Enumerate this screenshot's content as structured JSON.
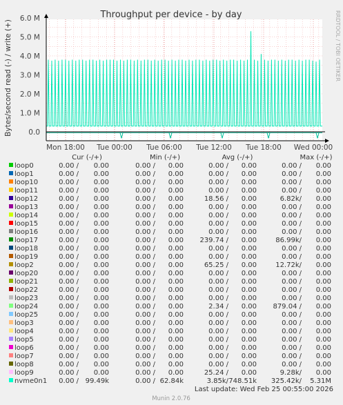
{
  "chart_data": {
    "type": "line",
    "title": "Throughput per device - by day",
    "ylabel": "Bytes/second read (-) / write (+)",
    "ylim": [
      -0.3,
      6.0
    ],
    "y_unit": "M",
    "y_ticks": [
      "0.0",
      "1.0 M",
      "2.0 M",
      "3.0 M",
      "4.0 M",
      "5.0 M",
      "6.0 M"
    ],
    "x_ticks": [
      "Mon 18:00",
      "Tue 00:00",
      "Tue 06:00",
      "Tue 12:00",
      "Tue 18:00",
      "Wed 00:00"
    ],
    "x_range": [
      "Mon 14:00",
      "Wed 02:40"
    ],
    "grid": true,
    "series": [
      {
        "name": "nvme0n1",
        "color": "#00E6B4",
        "approx_write_peaks_M": [
          3.8,
          3.75,
          3.8,
          3.75,
          3.8,
          3.8,
          3.75,
          3.8,
          3.75,
          3.8,
          3.8,
          3.75,
          3.8,
          3.8,
          3.75,
          3.8,
          3.75,
          3.8,
          3.8,
          3.8,
          3.75,
          3.8,
          3.75,
          3.8,
          3.8,
          3.75,
          3.8,
          3.75,
          3.8,
          3.8,
          3.75,
          3.8,
          3.75,
          3.8,
          3.8,
          3.75,
          3.8,
          3.75,
          3.8,
          3.8,
          3.75,
          3.8,
          3.75,
          3.8,
          3.8,
          3.75,
          3.8,
          3.75,
          3.8,
          3.8,
          3.75,
          3.8,
          3.75,
          3.8,
          3.8,
          3.75,
          3.8,
          3.75,
          3.8,
          5.3,
          3.8,
          3.75,
          4.1,
          3.8,
          3.75,
          3.8,
          3.8,
          3.75,
          3.8,
          3.75,
          3.8,
          3.8,
          3.75,
          3.8,
          3.75,
          3.8,
          3.8,
          3.75,
          3.7,
          3.8
        ],
        "write_baseline_M": 0.3,
        "read_baseline_M": -0.05
      }
    ]
  },
  "legend": {
    "headers": [
      "Cur (-/+)",
      "Min (-/+)",
      "Avg (-/+)",
      "Max (-/+)"
    ],
    "rows": [
      {
        "name": "loop0",
        "color": "#00CC00",
        "cur": "0.00 /",
        "cur2": "0.00",
        "min": "0.00 /",
        "min2": "0.00",
        "avg": "0.00 /",
        "avg2": "0.00",
        "max": "0.00 /",
        "max2": "0.00"
      },
      {
        "name": "loop1",
        "color": "#0066B3",
        "cur": "0.00 /",
        "cur2": "0.00",
        "min": "0.00 /",
        "min2": "0.00",
        "avg": "0.00 /",
        "avg2": "0.00",
        "max": "0.00 /",
        "max2": "0.00"
      },
      {
        "name": "loop10",
        "color": "#FF8000",
        "cur": "0.00 /",
        "cur2": "0.00",
        "min": "0.00 /",
        "min2": "0.00",
        "avg": "0.00 /",
        "avg2": "0.00",
        "max": "0.00 /",
        "max2": "0.00"
      },
      {
        "name": "loop11",
        "color": "#FFCC00",
        "cur": "0.00 /",
        "cur2": "0.00",
        "min": "0.00 /",
        "min2": "0.00",
        "avg": "0.00 /",
        "avg2": "0.00",
        "max": "0.00 /",
        "max2": "0.00"
      },
      {
        "name": "loop12",
        "color": "#330099",
        "cur": "0.00 /",
        "cur2": "0.00",
        "min": "0.00 /",
        "min2": "0.00",
        "avg": "18.56 /",
        "avg2": "0.00",
        "max": "6.82k/",
        "max2": "0.00"
      },
      {
        "name": "loop13",
        "color": "#990099",
        "cur": "0.00 /",
        "cur2": "0.00",
        "min": "0.00 /",
        "min2": "0.00",
        "avg": "0.00 /",
        "avg2": "0.00",
        "max": "0.00 /",
        "max2": "0.00"
      },
      {
        "name": "loop14",
        "color": "#CCFF00",
        "cur": "0.00 /",
        "cur2": "0.00",
        "min": "0.00 /",
        "min2": "0.00",
        "avg": "0.00 /",
        "avg2": "0.00",
        "max": "0.00 /",
        "max2": "0.00"
      },
      {
        "name": "loop15",
        "color": "#FF0000",
        "cur": "0.00 /",
        "cur2": "0.00",
        "min": "0.00 /",
        "min2": "0.00",
        "avg": "0.00 /",
        "avg2": "0.00",
        "max": "0.00 /",
        "max2": "0.00"
      },
      {
        "name": "loop16",
        "color": "#808080",
        "cur": "0.00 /",
        "cur2": "0.00",
        "min": "0.00 /",
        "min2": "0.00",
        "avg": "0.00 /",
        "avg2": "0.00",
        "max": "0.00 /",
        "max2": "0.00"
      },
      {
        "name": "loop17",
        "color": "#008F00",
        "cur": "0.00 /",
        "cur2": "0.00",
        "min": "0.00 /",
        "min2": "0.00",
        "avg": "239.74 /",
        "avg2": "0.00",
        "max": "86.99k/",
        "max2": "0.00"
      },
      {
        "name": "loop18",
        "color": "#00487D",
        "cur": "0.00 /",
        "cur2": "0.00",
        "min": "0.00 /",
        "min2": "0.00",
        "avg": "0.00 /",
        "avg2": "0.00",
        "max": "0.00 /",
        "max2": "0.00"
      },
      {
        "name": "loop19",
        "color": "#B35A00",
        "cur": "0.00 /",
        "cur2": "0.00",
        "min": "0.00 /",
        "min2": "0.00",
        "avg": "0.00 /",
        "avg2": "0.00",
        "max": "0.00 /",
        "max2": "0.00"
      },
      {
        "name": "loop2",
        "color": "#B38F00",
        "cur": "0.00 /",
        "cur2": "0.00",
        "min": "0.00 /",
        "min2": "0.00",
        "avg": "65.25 /",
        "avg2": "0.00",
        "max": "12.72k/",
        "max2": "0.00"
      },
      {
        "name": "loop20",
        "color": "#6B006B",
        "cur": "0.00 /",
        "cur2": "0.00",
        "min": "0.00 /",
        "min2": "0.00",
        "avg": "0.00 /",
        "avg2": "0.00",
        "max": "0.00 /",
        "max2": "0.00"
      },
      {
        "name": "loop21",
        "color": "#8FB300",
        "cur": "0.00 /",
        "cur2": "0.00",
        "min": "0.00 /",
        "min2": "0.00",
        "avg": "0.00 /",
        "avg2": "0.00",
        "max": "0.00 /",
        "max2": "0.00"
      },
      {
        "name": "loop22",
        "color": "#B30000",
        "cur": "0.00 /",
        "cur2": "0.00",
        "min": "0.00 /",
        "min2": "0.00",
        "avg": "0.00 /",
        "avg2": "0.00",
        "max": "0.00 /",
        "max2": "0.00"
      },
      {
        "name": "loop23",
        "color": "#BEBEBE",
        "cur": "0.00 /",
        "cur2": "0.00",
        "min": "0.00 /",
        "min2": "0.00",
        "avg": "0.00 /",
        "avg2": "0.00",
        "max": "0.00 /",
        "max2": "0.00"
      },
      {
        "name": "loop24",
        "color": "#80FF80",
        "cur": "0.00 /",
        "cur2": "0.00",
        "min": "0.00 /",
        "min2": "0.00",
        "avg": "2.34 /",
        "avg2": "0.00",
        "max": "879.04 /",
        "max2": "0.00"
      },
      {
        "name": "loop25",
        "color": "#80C9FF",
        "cur": "0.00 /",
        "cur2": "0.00",
        "min": "0.00 /",
        "min2": "0.00",
        "avg": "0.00 /",
        "avg2": "0.00",
        "max": "0.00 /",
        "max2": "0.00"
      },
      {
        "name": "loop3",
        "color": "#FFC080",
        "cur": "0.00 /",
        "cur2": "0.00",
        "min": "0.00 /",
        "min2": "0.00",
        "avg": "0.00 /",
        "avg2": "0.00",
        "max": "0.00 /",
        "max2": "0.00"
      },
      {
        "name": "loop4",
        "color": "#FFE680",
        "cur": "0.00 /",
        "cur2": "0.00",
        "min": "0.00 /",
        "min2": "0.00",
        "avg": "0.00 /",
        "avg2": "0.00",
        "max": "0.00 /",
        "max2": "0.00"
      },
      {
        "name": "loop5",
        "color": "#AA80FF",
        "cur": "0.00 /",
        "cur2": "0.00",
        "min": "0.00 /",
        "min2": "0.00",
        "avg": "0.00 /",
        "avg2": "0.00",
        "max": "0.00 /",
        "max2": "0.00"
      },
      {
        "name": "loop6",
        "color": "#EE00CC",
        "cur": "0.00 /",
        "cur2": "0.00",
        "min": "0.00 /",
        "min2": "0.00",
        "avg": "0.00 /",
        "avg2": "0.00",
        "max": "0.00 /",
        "max2": "0.00"
      },
      {
        "name": "loop7",
        "color": "#FF8080",
        "cur": "0.00 /",
        "cur2": "0.00",
        "min": "0.00 /",
        "min2": "0.00",
        "avg": "0.00 /",
        "avg2": "0.00",
        "max": "0.00 /",
        "max2": "0.00"
      },
      {
        "name": "loop8",
        "color": "#666600",
        "cur": "0.00 /",
        "cur2": "0.00",
        "min": "0.00 /",
        "min2": "0.00",
        "avg": "0.00 /",
        "avg2": "0.00",
        "max": "0.00 /",
        "max2": "0.00"
      },
      {
        "name": "loop9",
        "color": "#FFBFFF",
        "cur": "0.00 /",
        "cur2": "0.00",
        "min": "0.00 /",
        "min2": "0.00",
        "avg": "25.24 /",
        "avg2": "0.00",
        "max": "9.28k/",
        "max2": "0.00"
      },
      {
        "name": "nvme0n1",
        "color": "#00FFCC",
        "cur": "0.00 /",
        "cur2": "99.49k",
        "min": "0.00 /",
        "min2": "62.84k",
        "avg": "3.85k/",
        "avg2": "748.51k",
        "max": "325.42k/",
        "max2": "5.31M"
      }
    ]
  },
  "footer": {
    "last_update": "Last update: Wed Feb 25 00:55:00 2026",
    "munin": "Munin 2.0.76"
  },
  "watermark": "RRDTOOL / TOBI OETIKER",
  "colors": {
    "background": "#F0F0F0",
    "canvas": "#FFFFFF",
    "grid": "#F0A0A0",
    "axis": "#000000"
  }
}
